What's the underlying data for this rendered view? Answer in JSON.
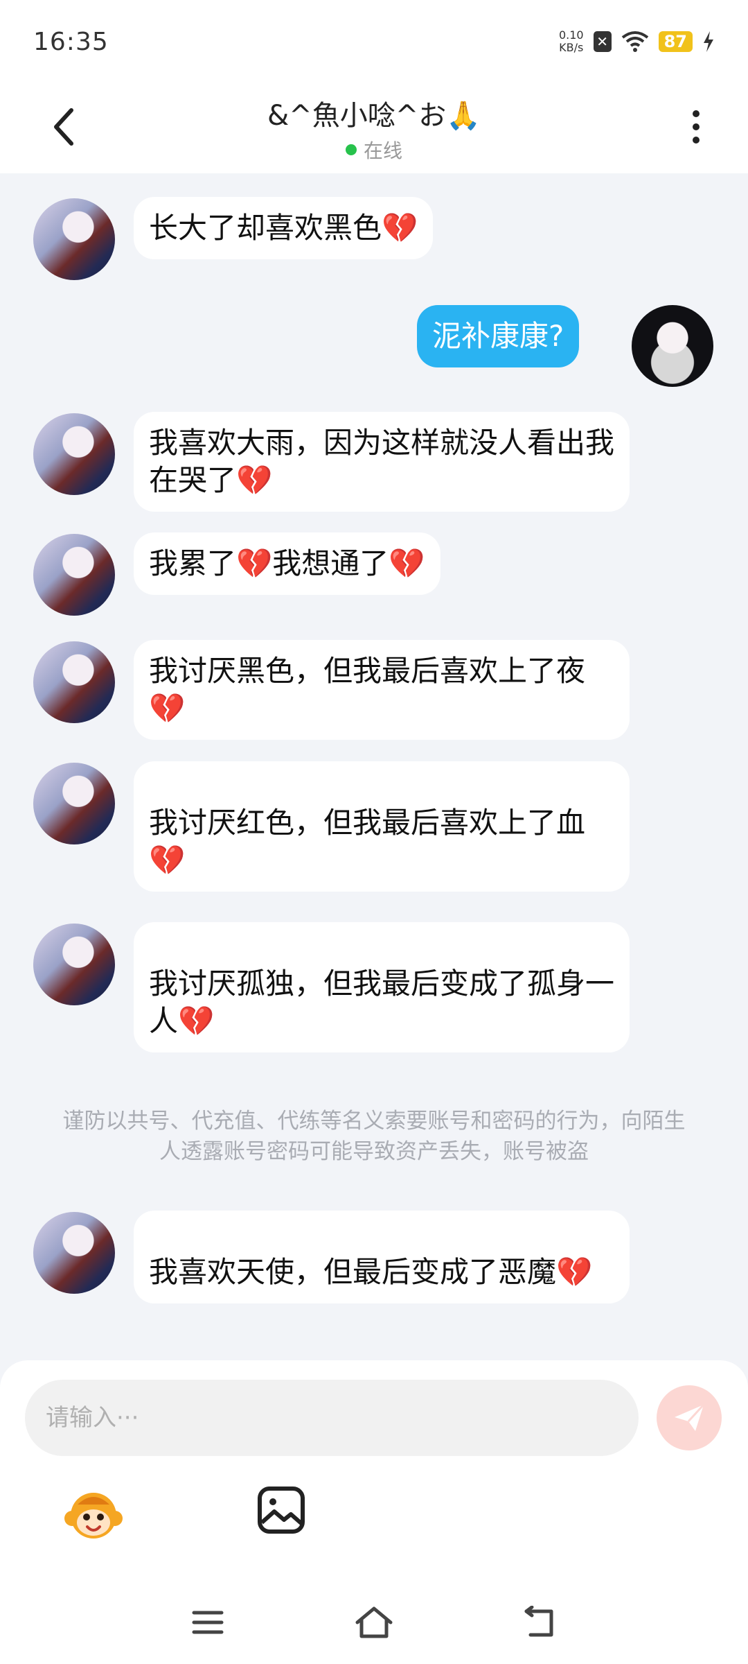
{
  "status_bar": {
    "time": "16:35",
    "net_speed_value": "0.10",
    "net_speed_unit": "KB/s",
    "battery": "87"
  },
  "header": {
    "title": "&^魚小唸^お🙏",
    "status": "在线"
  },
  "messages": [
    {
      "side": "left",
      "text": "长大了却喜欢黑色",
      "heart": "💔"
    },
    {
      "side": "right",
      "text": "泥补康康?"
    },
    {
      "side": "left",
      "text": "我喜欢大雨，因为这样就没人看出我在哭了",
      "heart": "💔"
    },
    {
      "side": "left",
      "text": "我累了💔我想通了",
      "heart": "💔"
    },
    {
      "side": "left",
      "text": "我讨厌黑色，但我最后喜欢上了夜",
      "heart": "💔"
    },
    {
      "side": "left",
      "text": "我讨厌红色，但我最后喜欢上了血",
      "heart": "💔"
    },
    {
      "side": "left",
      "text": "我讨厌孤独，但我最后变成了孤身一人",
      "heart": "💔"
    },
    {
      "side": "left",
      "text": "我喜欢天使，但最后变成了恶魔",
      "heart": "💔"
    }
  ],
  "notice": "谨防以共号、代充值、代练等名义索要账号和密码的行为，向陌生人透露账号密码可能导致资产丢失，账号被盗",
  "input": {
    "placeholder": "请输入···"
  },
  "icons": {
    "back": "chevron-left-icon",
    "more": "more-vertical-icon",
    "send": "paper-plane-icon",
    "emoji": "monkey-emoji-icon",
    "image": "image-icon",
    "nav_menu": "menu-icon",
    "nav_home": "home-icon",
    "nav_back": "back-arrow-icon"
  },
  "colors": {
    "accent_blue": "#2ab3f2",
    "online_green": "#27c24c",
    "heart_red": "#d81b3c",
    "send_disabled": "#fcd7d3"
  }
}
